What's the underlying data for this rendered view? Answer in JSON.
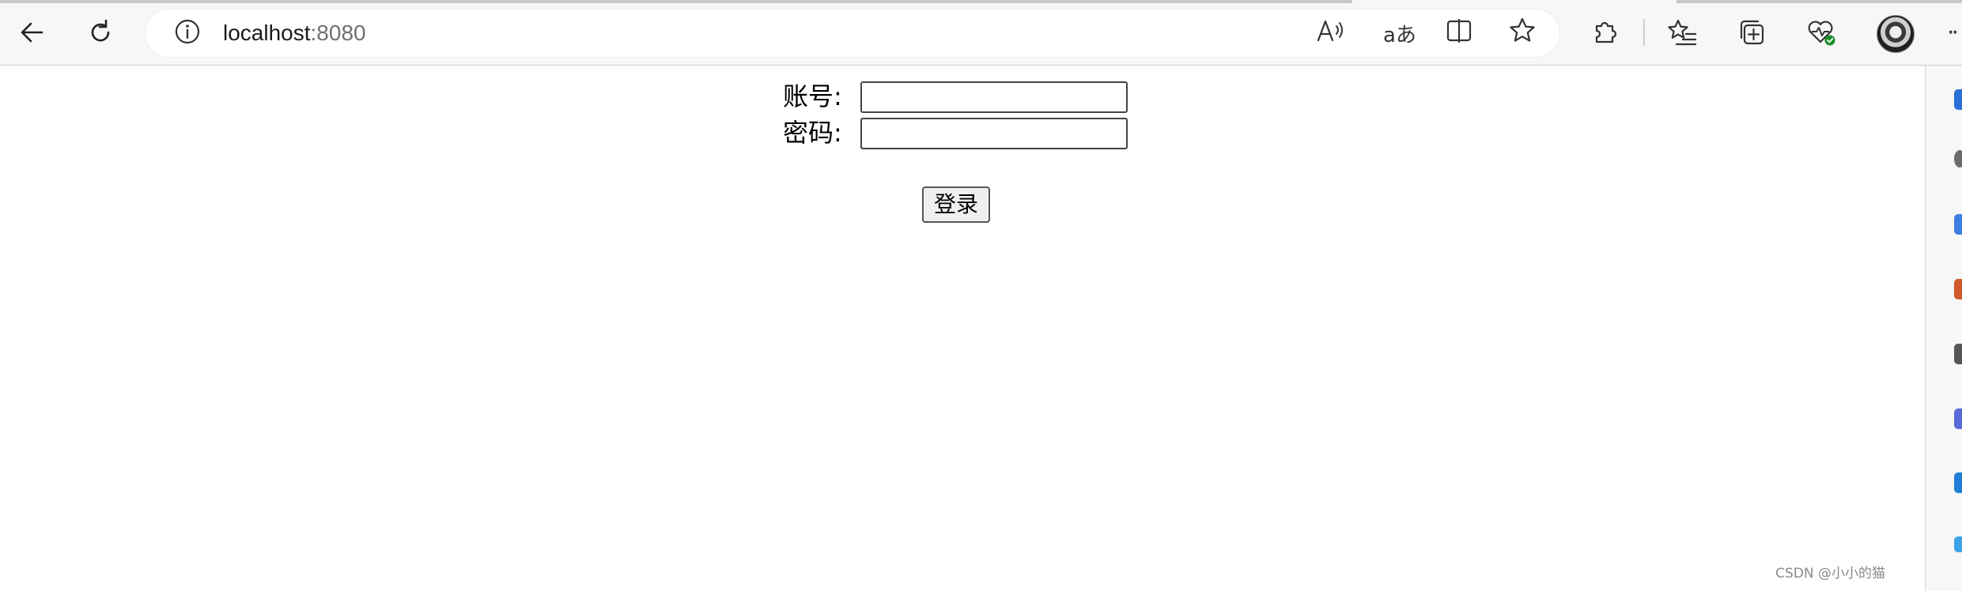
{
  "browser": {
    "address": {
      "host": "localhost",
      "port": ":8080"
    },
    "toolbar_icons": [
      "back-icon",
      "refresh-icon",
      "info-icon",
      "read-aloud-icon",
      "translate-icon",
      "split-screen-icon",
      "favorite-star-icon",
      "extensions-icon",
      "favorites-list-icon",
      "collections-icon",
      "browser-essentials-icon",
      "profile-avatar",
      "more-icon"
    ],
    "translate_glyph": "aあ",
    "read_aloud_glyph": "A",
    "accent_color": "#1c8f2a"
  },
  "form": {
    "account_label": "账号:",
    "account_value": "",
    "password_label": "密码:",
    "password_value": "",
    "login_button": "登录"
  },
  "watermark": "CSDN @小小的猫"
}
